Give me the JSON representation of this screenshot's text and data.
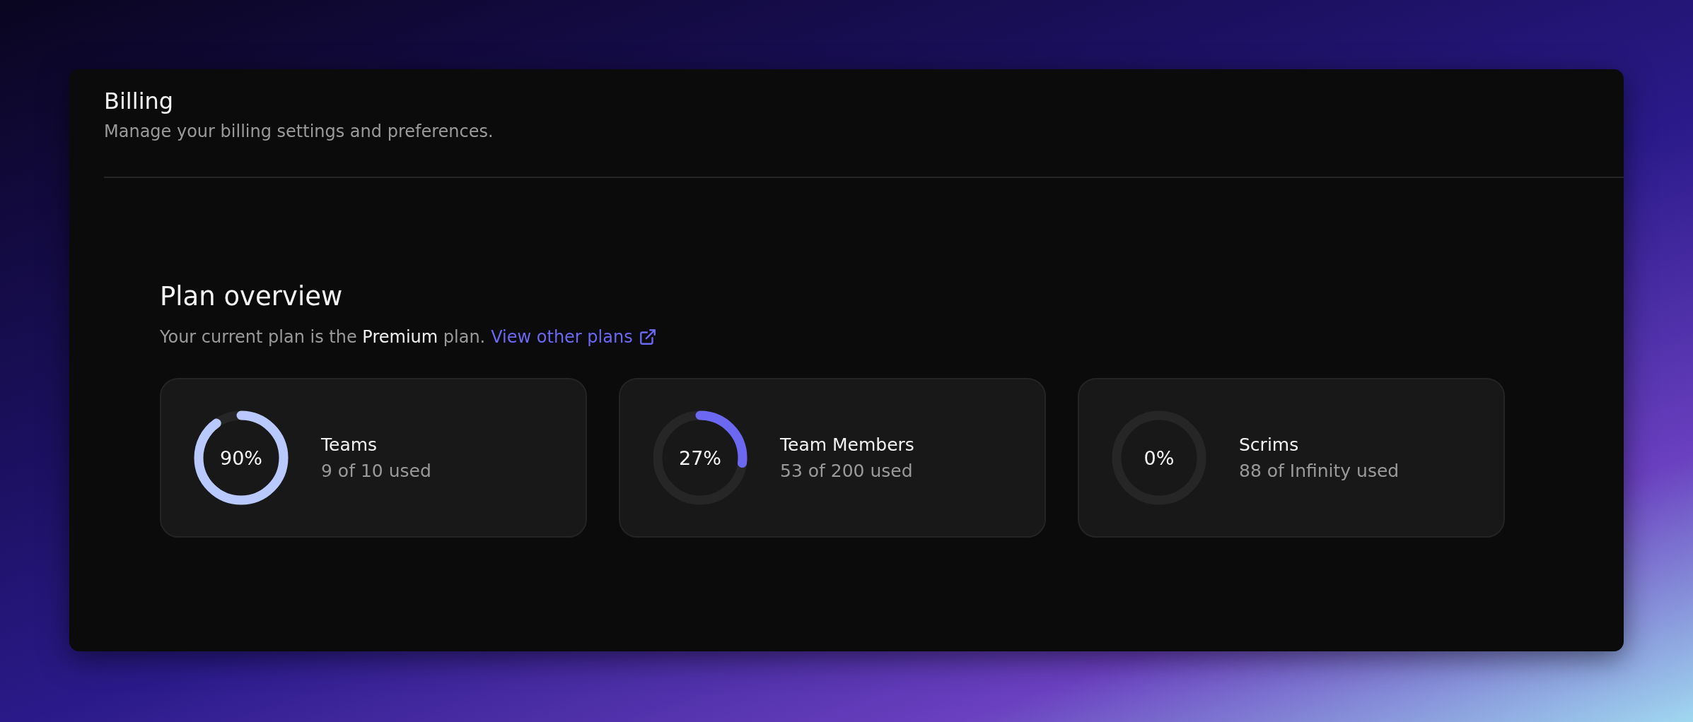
{
  "header": {
    "title": "Billing",
    "subtitle": "Manage your billing settings and preferences."
  },
  "plan": {
    "title": "Plan overview",
    "sentence": "Your current plan is the **Premium** plan.",
    "link": "View other plans"
  },
  "meters": [
    {
      "percent": "90%",
      "name": "Teams",
      "usage": "9 of 10 used",
      "level": 0.9,
      "color": "#b9c9fe"
    },
    {
      "percent": "27%",
      "name": "Team Members",
      "usage": "53 of 200 used",
      "level": 0.27,
      "color": "#6c68f2"
    },
    {
      "percent": "0%",
      "name": "Scrims",
      "usage": "88 of Infinity used",
      "level": 0
    }
  ]
}
